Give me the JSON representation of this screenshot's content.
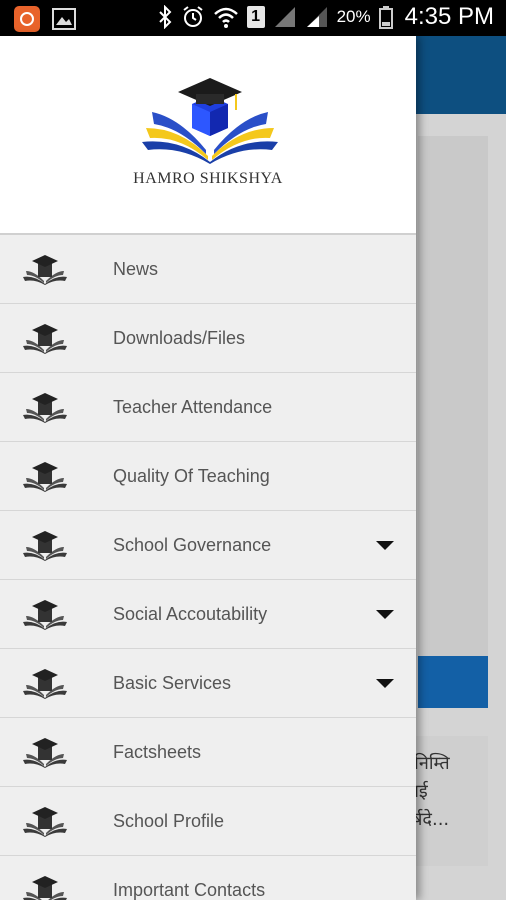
{
  "status_bar": {
    "battery_percent": "20%",
    "time": "4:35 PM",
    "sim": "1"
  },
  "drawer": {
    "brand": "HAMRO SHIKSHYA",
    "items": [
      {
        "label": "News",
        "expandable": false
      },
      {
        "label": "Downloads/Files",
        "expandable": false
      },
      {
        "label": "Teacher Attendance",
        "expandable": false
      },
      {
        "label": "Quality Of Teaching",
        "expandable": false
      },
      {
        "label": "School Governance",
        "expandable": true
      },
      {
        "label": "Social Accoutability",
        "expandable": true
      },
      {
        "label": "Basic Services",
        "expandable": true
      },
      {
        "label": "Factsheets",
        "expandable": false
      },
      {
        "label": "School Profile",
        "expandable": false
      },
      {
        "label": "Important Contacts",
        "expandable": false
      }
    ]
  },
  "background": {
    "news_snippet": "सनिम्ति\nलाई\nवर्षदे..."
  }
}
